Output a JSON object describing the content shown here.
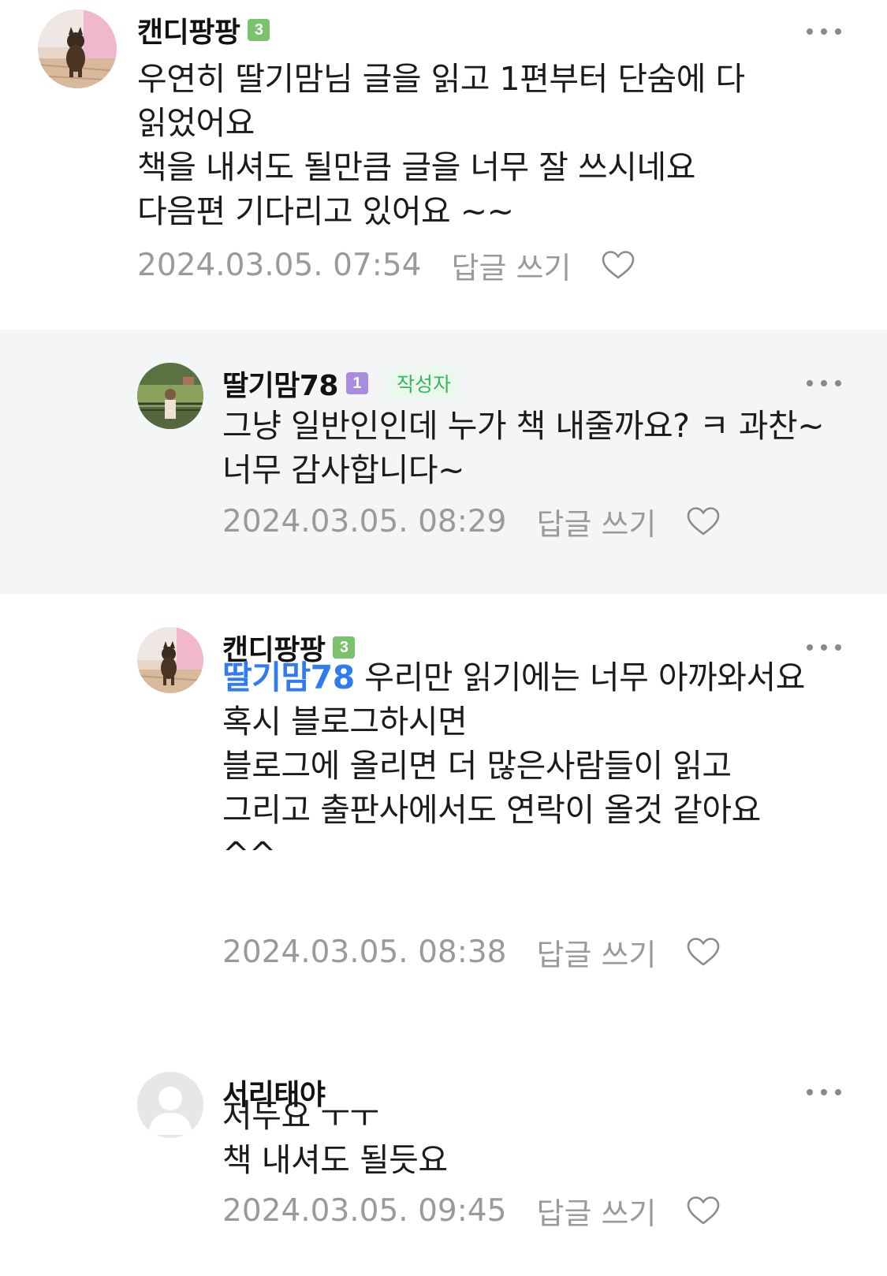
{
  "comments": [
    {
      "nickname": "캔디팡팡",
      "level": "3",
      "text": "우연히 딸기맘님 글을 읽고 1편부터 단숨에 다 읽었어요\n책을 내셔도 될만큼 글을 너무 잘 쓰시네요\n다음편 기다리고 있어요 ~~",
      "date": "2024.03.05. 07:54",
      "reply_label": "답글 쓰기",
      "avatar_icon": "dog-photo-avatar",
      "like_icon": "heart-outline-icon"
    },
    {
      "nickname": "딸기맘78",
      "level": "1",
      "author_badge": "작성자",
      "text": "그냥 일반인인데 누가 책 내줄까요? ㅋ 과찬~너무 감사합니다~",
      "date": "2024.03.05. 08:29",
      "reply_label": "답글 쓰기",
      "avatar_icon": "garden-person-photo-avatar",
      "like_icon": "heart-outline-icon"
    },
    {
      "nickname": "캔디팡팡",
      "level": "3",
      "mention": "딸기맘78",
      "text": " 우리만 읽기에는 너무 아까와서요\n혹시 블로그하시면\n블로그에 올리면 더 많은사람들이 읽고\n그리고 출판사에서도 연락이 올것 같아요\n^^",
      "date": "2024.03.05. 08:38",
      "reply_label": "답글 쓰기",
      "avatar_icon": "dog-photo-avatar",
      "like_icon": "heart-outline-icon"
    },
    {
      "nickname": "서리태야",
      "text": "저두요 ㅜㅜ\n책 내셔도 될듯요",
      "date": "2024.03.05. 09:45",
      "reply_label": "답글 쓰기",
      "avatar_icon": "default-person-avatar",
      "like_icon": "heart-outline-icon"
    }
  ],
  "colors": {
    "mention": "#2f7bef",
    "level_green": "#7ac26b",
    "level_purple": "#a98be0",
    "author_badge_text": "#37b758",
    "reply_background": "#f4f5f6"
  }
}
